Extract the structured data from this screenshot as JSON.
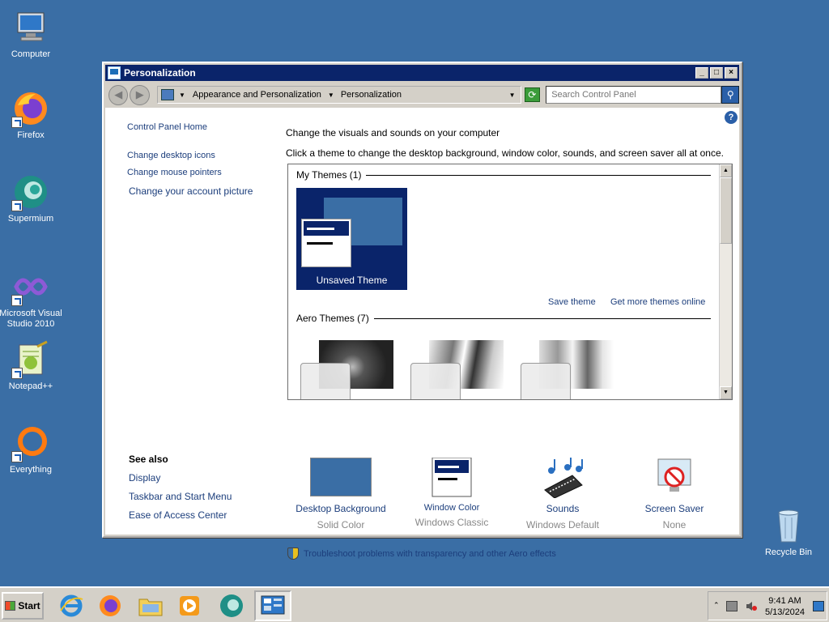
{
  "desktop": {
    "icons": [
      {
        "label": "Computer"
      },
      {
        "label": "Firefox"
      },
      {
        "label": "Supermium"
      },
      {
        "label": "Microsoft Visual Studio 2010"
      },
      {
        "label": "Notepad++"
      },
      {
        "label": "Everything"
      }
    ],
    "recycle_bin_label": "Recycle Bin"
  },
  "window": {
    "title": "Personalization",
    "breadcrumb": [
      "Appearance and Personalization",
      "Personalization"
    ],
    "search_placeholder": "Search Control Panel",
    "left_pane": {
      "home": "Control Panel Home",
      "links": [
        "Change desktop icons",
        "Change mouse pointers",
        "Change your account picture"
      ],
      "see_also_title": "See also",
      "see_also": [
        "Display",
        "Taskbar and Start Menu",
        "Ease of Access Center"
      ]
    },
    "heading": "Change the visuals and sounds on your computer",
    "subheading": "Click a theme to change the desktop background, window color, sounds, and screen saver all at once.",
    "themes": {
      "my_themes_header": "My Themes (1)",
      "unsaved_theme": "Unsaved Theme",
      "save_theme": "Save theme",
      "more_themes": "Get more themes online",
      "aero_header": "Aero Themes (7)"
    },
    "bottom_items": [
      {
        "label": "Desktop Background",
        "value": "Solid Color",
        "icon": "desktop-background-icon"
      },
      {
        "label": "Window Color",
        "value": "Windows Classic",
        "icon": "window-color-icon"
      },
      {
        "label": "Sounds",
        "value": "Windows Default",
        "icon": "sounds-icon"
      },
      {
        "label": "Screen Saver",
        "value": "None",
        "icon": "screen-saver-icon"
      }
    ],
    "troubleshoot": "Troubleshoot problems with transparency and other Aero effects"
  },
  "taskbar": {
    "start_label": "Start",
    "clock_time": "9:41 AM",
    "clock_date": "5/13/2024"
  },
  "colors": {
    "desktop": "#3a6ea5",
    "titlebar": "#0a246a",
    "link": "#1c3e7c"
  }
}
